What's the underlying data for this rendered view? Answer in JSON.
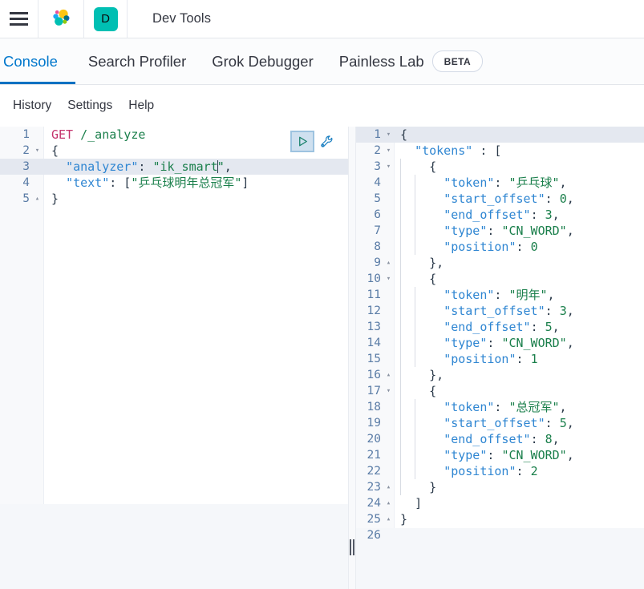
{
  "chrome": {
    "menu_icon": "hamburger-menu-icon",
    "logo_icon": "elastic-logo-icon",
    "space_initial": "D",
    "title": "Dev Tools"
  },
  "app_tabs": [
    {
      "label": "Console",
      "active": true,
      "badge": null
    },
    {
      "label": "Search Profiler",
      "active": false,
      "badge": null
    },
    {
      "label": "Grok Debugger",
      "active": false,
      "badge": null
    },
    {
      "label": "Painless Lab",
      "active": false,
      "badge": "BETA"
    }
  ],
  "console_nav": [
    {
      "label": "History"
    },
    {
      "label": "Settings"
    },
    {
      "label": "Help"
    }
  ],
  "editor_actions": {
    "play_label": "send-request",
    "wrench_label": "request-options"
  },
  "request_editor": {
    "active_line": 3,
    "lines": [
      {
        "num": "1",
        "fold": "",
        "tokens": [
          {
            "t": "GET",
            "c": "tok-method"
          },
          {
            "t": " ",
            "c": "tok-plain"
          },
          {
            "t": "/_analyze",
            "c": "tok-url"
          }
        ]
      },
      {
        "num": "2",
        "fold": "▾",
        "tokens": [
          {
            "t": "{",
            "c": "tok-punct"
          }
        ]
      },
      {
        "num": "3",
        "fold": "",
        "tokens": [
          {
            "t": "  ",
            "c": "tok-plain"
          },
          {
            "t": "\"analyzer\"",
            "c": "tok-key"
          },
          {
            "t": ": ",
            "c": "tok-punct"
          },
          {
            "t": "\"ik_smart",
            "c": "tok-string"
          },
          {
            "t": "CARET",
            "c": "caret"
          },
          {
            "t": "\"",
            "c": "tok-string"
          },
          {
            "t": ",",
            "c": "tok-punct"
          }
        ]
      },
      {
        "num": "4",
        "fold": "",
        "tokens": [
          {
            "t": "  ",
            "c": "tok-plain"
          },
          {
            "t": "\"text\"",
            "c": "tok-key"
          },
          {
            "t": ": [",
            "c": "tok-punct"
          },
          {
            "t": "\"乒乓球明年总冠军\"",
            "c": "tok-string"
          },
          {
            "t": "]",
            "c": "tok-punct"
          }
        ]
      },
      {
        "num": "5",
        "fold": "▴",
        "tokens": [
          {
            "t": "}",
            "c": "tok-punct"
          }
        ]
      }
    ]
  },
  "response_editor": {
    "active_line": 1,
    "lines": [
      {
        "num": "1",
        "fold": "▾",
        "indent": 0,
        "tokens": [
          {
            "t": "{",
            "c": "tok-punct"
          }
        ]
      },
      {
        "num": "2",
        "fold": "▾",
        "indent": 0,
        "tokens": [
          {
            "t": "  ",
            "c": "tok-plain"
          },
          {
            "t": "\"tokens\"",
            "c": "tok-key"
          },
          {
            "t": " : [",
            "c": "tok-punct"
          }
        ]
      },
      {
        "num": "3",
        "fold": "▾",
        "indent": 1,
        "tokens": [
          {
            "t": "    ",
            "c": "tok-plain"
          },
          {
            "t": "{",
            "c": "tok-punct"
          }
        ]
      },
      {
        "num": "4",
        "fold": "",
        "indent": 2,
        "tokens": [
          {
            "t": "      ",
            "c": "tok-plain"
          },
          {
            "t": "\"token\"",
            "c": "tok-key"
          },
          {
            "t": " : ",
            "c": "tok-punct"
          },
          {
            "t": "\"乒乓球\"",
            "c": "tok-string"
          },
          {
            "t": ",",
            "c": "tok-punct"
          }
        ]
      },
      {
        "num": "5",
        "fold": "",
        "indent": 2,
        "tokens": [
          {
            "t": "      ",
            "c": "tok-plain"
          },
          {
            "t": "\"start_offset\"",
            "c": "tok-key"
          },
          {
            "t": " : ",
            "c": "tok-punct"
          },
          {
            "t": "0",
            "c": "tok-number"
          },
          {
            "t": ",",
            "c": "tok-punct"
          }
        ]
      },
      {
        "num": "6",
        "fold": "",
        "indent": 2,
        "tokens": [
          {
            "t": "      ",
            "c": "tok-plain"
          },
          {
            "t": "\"end_offset\"",
            "c": "tok-key"
          },
          {
            "t": " : ",
            "c": "tok-punct"
          },
          {
            "t": "3",
            "c": "tok-number"
          },
          {
            "t": ",",
            "c": "tok-punct"
          }
        ]
      },
      {
        "num": "7",
        "fold": "",
        "indent": 2,
        "tokens": [
          {
            "t": "      ",
            "c": "tok-plain"
          },
          {
            "t": "\"type\"",
            "c": "tok-key"
          },
          {
            "t": " : ",
            "c": "tok-punct"
          },
          {
            "t": "\"CN_WORD\"",
            "c": "tok-string"
          },
          {
            "t": ",",
            "c": "tok-punct"
          }
        ]
      },
      {
        "num": "8",
        "fold": "",
        "indent": 2,
        "tokens": [
          {
            "t": "      ",
            "c": "tok-plain"
          },
          {
            "t": "\"position\"",
            "c": "tok-key"
          },
          {
            "t": " : ",
            "c": "tok-punct"
          },
          {
            "t": "0",
            "c": "tok-number"
          }
        ]
      },
      {
        "num": "9",
        "fold": "▴",
        "indent": 1,
        "tokens": [
          {
            "t": "    ",
            "c": "tok-plain"
          },
          {
            "t": "},",
            "c": "tok-punct"
          }
        ]
      },
      {
        "num": "10",
        "fold": "▾",
        "indent": 1,
        "tokens": [
          {
            "t": "    ",
            "c": "tok-plain"
          },
          {
            "t": "{",
            "c": "tok-punct"
          }
        ]
      },
      {
        "num": "11",
        "fold": "",
        "indent": 2,
        "tokens": [
          {
            "t": "      ",
            "c": "tok-plain"
          },
          {
            "t": "\"token\"",
            "c": "tok-key"
          },
          {
            "t": " : ",
            "c": "tok-punct"
          },
          {
            "t": "\"明年\"",
            "c": "tok-string"
          },
          {
            "t": ",",
            "c": "tok-punct"
          }
        ]
      },
      {
        "num": "12",
        "fold": "",
        "indent": 2,
        "tokens": [
          {
            "t": "      ",
            "c": "tok-plain"
          },
          {
            "t": "\"start_offset\"",
            "c": "tok-key"
          },
          {
            "t": " : ",
            "c": "tok-punct"
          },
          {
            "t": "3",
            "c": "tok-number"
          },
          {
            "t": ",",
            "c": "tok-punct"
          }
        ]
      },
      {
        "num": "13",
        "fold": "",
        "indent": 2,
        "tokens": [
          {
            "t": "      ",
            "c": "tok-plain"
          },
          {
            "t": "\"end_offset\"",
            "c": "tok-key"
          },
          {
            "t": " : ",
            "c": "tok-punct"
          },
          {
            "t": "5",
            "c": "tok-number"
          },
          {
            "t": ",",
            "c": "tok-punct"
          }
        ]
      },
      {
        "num": "14",
        "fold": "",
        "indent": 2,
        "tokens": [
          {
            "t": "      ",
            "c": "tok-plain"
          },
          {
            "t": "\"type\"",
            "c": "tok-key"
          },
          {
            "t": " : ",
            "c": "tok-punct"
          },
          {
            "t": "\"CN_WORD\"",
            "c": "tok-string"
          },
          {
            "t": ",",
            "c": "tok-punct"
          }
        ]
      },
      {
        "num": "15",
        "fold": "",
        "indent": 2,
        "tokens": [
          {
            "t": "      ",
            "c": "tok-plain"
          },
          {
            "t": "\"position\"",
            "c": "tok-key"
          },
          {
            "t": " : ",
            "c": "tok-punct"
          },
          {
            "t": "1",
            "c": "tok-number"
          }
        ]
      },
      {
        "num": "16",
        "fold": "▴",
        "indent": 1,
        "tokens": [
          {
            "t": "    ",
            "c": "tok-plain"
          },
          {
            "t": "},",
            "c": "tok-punct"
          }
        ]
      },
      {
        "num": "17",
        "fold": "▾",
        "indent": 1,
        "tokens": [
          {
            "t": "    ",
            "c": "tok-plain"
          },
          {
            "t": "{",
            "c": "tok-punct"
          }
        ]
      },
      {
        "num": "18",
        "fold": "",
        "indent": 2,
        "tokens": [
          {
            "t": "      ",
            "c": "tok-plain"
          },
          {
            "t": "\"token\"",
            "c": "tok-key"
          },
          {
            "t": " : ",
            "c": "tok-punct"
          },
          {
            "t": "\"总冠军\"",
            "c": "tok-string"
          },
          {
            "t": ",",
            "c": "tok-punct"
          }
        ]
      },
      {
        "num": "19",
        "fold": "",
        "indent": 2,
        "tokens": [
          {
            "t": "      ",
            "c": "tok-plain"
          },
          {
            "t": "\"start_offset\"",
            "c": "tok-key"
          },
          {
            "t": " : ",
            "c": "tok-punct"
          },
          {
            "t": "5",
            "c": "tok-number"
          },
          {
            "t": ",",
            "c": "tok-punct"
          }
        ]
      },
      {
        "num": "20",
        "fold": "",
        "indent": 2,
        "tokens": [
          {
            "t": "      ",
            "c": "tok-plain"
          },
          {
            "t": "\"end_offset\"",
            "c": "tok-key"
          },
          {
            "t": " : ",
            "c": "tok-punct"
          },
          {
            "t": "8",
            "c": "tok-number"
          },
          {
            "t": ",",
            "c": "tok-punct"
          }
        ]
      },
      {
        "num": "21",
        "fold": "",
        "indent": 2,
        "tokens": [
          {
            "t": "      ",
            "c": "tok-plain"
          },
          {
            "t": "\"type\"",
            "c": "tok-key"
          },
          {
            "t": " : ",
            "c": "tok-punct"
          },
          {
            "t": "\"CN_WORD\"",
            "c": "tok-string"
          },
          {
            "t": ",",
            "c": "tok-punct"
          }
        ]
      },
      {
        "num": "22",
        "fold": "",
        "indent": 2,
        "tokens": [
          {
            "t": "      ",
            "c": "tok-plain"
          },
          {
            "t": "\"position\"",
            "c": "tok-key"
          },
          {
            "t": " : ",
            "c": "tok-punct"
          },
          {
            "t": "2",
            "c": "tok-number"
          }
        ]
      },
      {
        "num": "23",
        "fold": "▴",
        "indent": 1,
        "tokens": [
          {
            "t": "    ",
            "c": "tok-plain"
          },
          {
            "t": "}",
            "c": "tok-punct"
          }
        ]
      },
      {
        "num": "24",
        "fold": "▴",
        "indent": 0,
        "tokens": [
          {
            "t": "  ",
            "c": "tok-plain"
          },
          {
            "t": "]",
            "c": "tok-punct"
          }
        ]
      },
      {
        "num": "25",
        "fold": "▴",
        "indent": 0,
        "tokens": [
          {
            "t": "}",
            "c": "tok-punct"
          }
        ]
      },
      {
        "num": "26",
        "fold": "",
        "indent": 0,
        "tokens": []
      }
    ]
  },
  "colors": {
    "accent": "#0071c2",
    "teal": "#00bfb3",
    "active_line": "#e4e8f0",
    "method": "#c4336c",
    "key": "#2f86d2",
    "string": "#1a7f4b"
  }
}
